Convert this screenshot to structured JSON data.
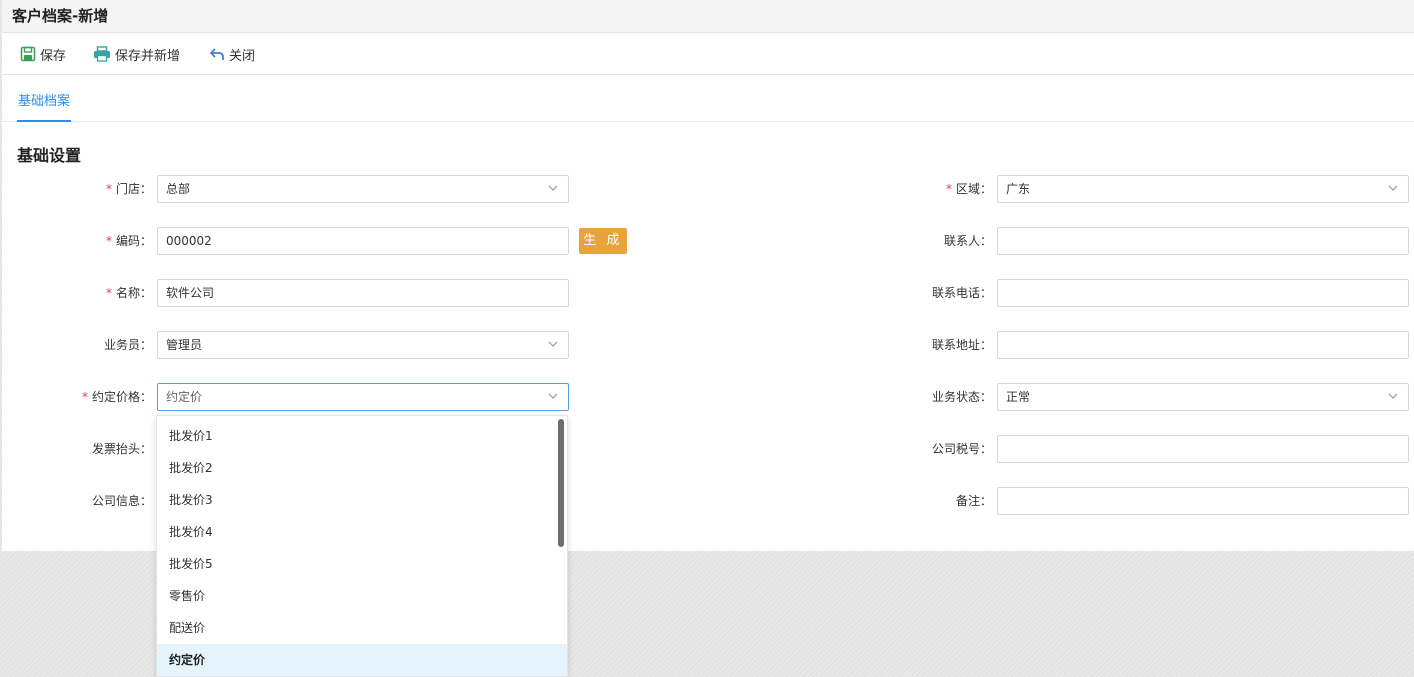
{
  "window": {
    "title": "客户档案-新增"
  },
  "toolbar": {
    "save_label": "保存",
    "save_new_label": "保存并新增",
    "close_label": "关闭"
  },
  "tabs": [
    {
      "label": "基础档案",
      "active": true
    }
  ],
  "section": {
    "title": "基础设置"
  },
  "form": {
    "store": {
      "label": "门店：",
      "required": true,
      "value": "总部"
    },
    "code": {
      "label": "编码：",
      "required": true,
      "value": "000002",
      "generate_label": "生 成"
    },
    "name": {
      "label": "名称：",
      "required": true,
      "value": "软件公司"
    },
    "salesperson": {
      "label": "业务员：",
      "required": false,
      "value": "管理员"
    },
    "price": {
      "label": "约定价格：",
      "required": true,
      "value": "约定价"
    },
    "invoice": {
      "label": "发票抬头：",
      "required": false,
      "value": ""
    },
    "company_info": {
      "label": "公司信息：",
      "required": false,
      "value": ""
    },
    "region": {
      "label": "区域：",
      "required": true,
      "value": "广东"
    },
    "contact": {
      "label": "联系人：",
      "required": false,
      "value": ""
    },
    "phone": {
      "label": "联系电话：",
      "required": false,
      "value": ""
    },
    "address": {
      "label": "联系地址：",
      "required": false,
      "value": ""
    },
    "status": {
      "label": "业务状态：",
      "required": false,
      "value": "正常"
    },
    "tax_no": {
      "label": "公司税号：",
      "required": false,
      "value": ""
    },
    "remark": {
      "label": "备注：",
      "required": false,
      "value": ""
    }
  },
  "price_dropdown": {
    "options": [
      "批发价1",
      "批发价2",
      "批发价3",
      "批发价4",
      "批发价5",
      "零售价",
      "配送价",
      "约定价"
    ],
    "selected": "约定价"
  },
  "colors": {
    "accent": "#2d8cf0",
    "required": "#e03c3c",
    "generate_button": "#e8a33d",
    "selected_option_bg": "#e6f4fc"
  },
  "icons": {
    "save": "save-icon",
    "save_new": "printer-icon",
    "close": "undo-arrow-icon",
    "select": "chevron-down-icon"
  }
}
